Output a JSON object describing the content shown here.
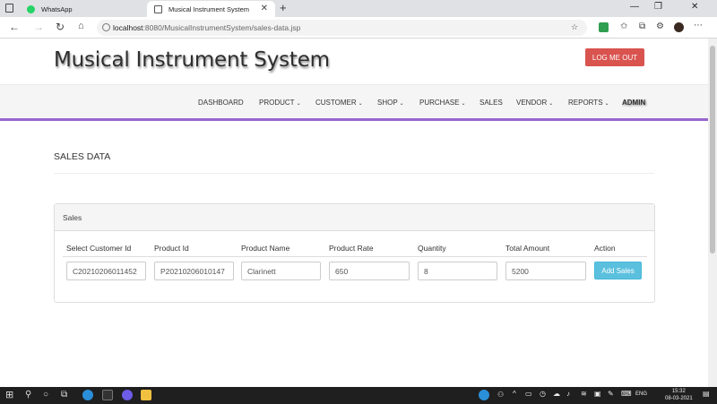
{
  "browser": {
    "tabs": [
      {
        "title": "WhatsApp",
        "active": false,
        "favicon": "whatsapp-icon"
      },
      {
        "title": "Musical Instrument System",
        "active": true,
        "favicon": "page-icon"
      }
    ],
    "url_host": "localhost",
    "url_path": ":8080/MusicalInstrumentSystem/sales-data.jsp"
  },
  "header": {
    "title": "Musical Instrument System",
    "logout_label": "LOG ME OUT"
  },
  "nav": {
    "items": [
      {
        "label": "DASHBOARD",
        "dropdown": false
      },
      {
        "label": "PRODUCT",
        "dropdown": true
      },
      {
        "label": "CUSTOMER",
        "dropdown": true
      },
      {
        "label": "SHOP",
        "dropdown": true
      },
      {
        "label": "PURCHASE",
        "dropdown": true
      },
      {
        "label": "SALES",
        "dropdown": false
      },
      {
        "label": "VENDOR",
        "dropdown": true
      },
      {
        "label": "REPORTS",
        "dropdown": true
      },
      {
        "label": "ADMIN",
        "dropdown": false
      }
    ]
  },
  "main": {
    "title": "SALES DATA",
    "panel_heading": "Sales",
    "columns": [
      "Select Customer Id",
      "Product Id",
      "Product Name",
      "Product Rate",
      "Quantity",
      "Total Amount",
      "Action"
    ],
    "row": {
      "customer_id": "C20210206011452",
      "product_id": "P20210206010147",
      "product_name": "Clarinett",
      "product_rate": "650",
      "quantity": "8",
      "total_amount": "5200"
    },
    "add_label": "Add Sales"
  },
  "taskbar": {
    "language": "ENG",
    "time": "15:32",
    "date": "08-03-2021"
  },
  "colors": {
    "logout": "#d9534f",
    "nav_underline": "#9966cc",
    "add_button": "#5bc0de",
    "taskbar": "#1f1f1f"
  }
}
